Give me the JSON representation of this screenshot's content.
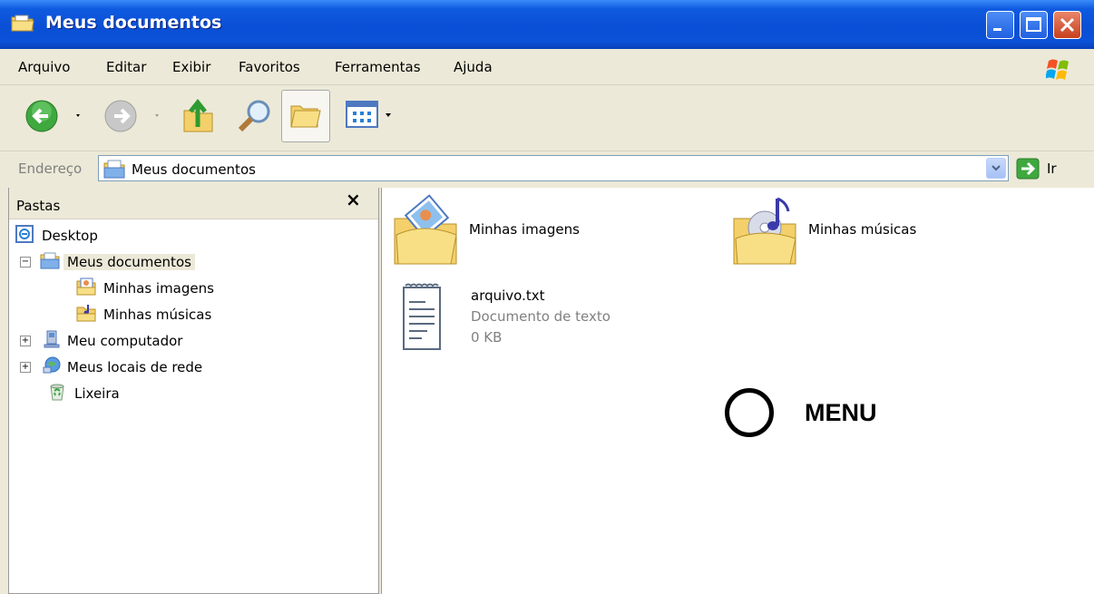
{
  "window": {
    "title": "Meus documentos",
    "controls": {
      "minimize": "minimize",
      "maximize": "maximize",
      "close": "close"
    }
  },
  "menu": [
    "Arquivo",
    "Editar",
    "Exibir",
    "Favoritos",
    "Ferramentas",
    "Ajuda"
  ],
  "toolbar": {
    "buttons": [
      "back-icon",
      "forward-icon",
      "up-folder-icon",
      "search-icon",
      "folders-icon",
      "views-icon"
    ]
  },
  "address": {
    "label": "Endereço",
    "value": "Meus documentos",
    "go_label": "Ir"
  },
  "folders_pane": {
    "title": "Pastas",
    "close": "×",
    "tree": [
      {
        "label": "Desktop",
        "icon": "desktop-icon"
      },
      {
        "label": "Meus documentos",
        "icon": "documents-folder-icon",
        "expander": "−",
        "selected": true
      },
      {
        "label": "Minhas imagens",
        "icon": "pictures-folder-icon"
      },
      {
        "label": "Minhas músicas",
        "icon": "music-folder-icon"
      },
      {
        "label": "Meu computador",
        "icon": "computer-icon",
        "expander": "+"
      },
      {
        "label": "Meus locais de rede",
        "icon": "network-icon",
        "expander": "+"
      },
      {
        "label": "Lixeira",
        "icon": "recycle-bin-icon"
      }
    ]
  },
  "content": {
    "items": [
      {
        "name": "Minhas imagens",
        "icon": "pictures-folder-icon"
      },
      {
        "name": "Minhas músicas",
        "icon": "music-folder-icon"
      },
      {
        "name": "arquivo.txt",
        "type": "Documento de texto",
        "size": "0 KB",
        "icon": "text-file-icon"
      }
    ]
  },
  "annotation": {
    "text": "MENU"
  },
  "colors": {
    "titlebar": "#0A4FD6",
    "chrome": "#ECE9D8",
    "folder": "#F6D872"
  }
}
